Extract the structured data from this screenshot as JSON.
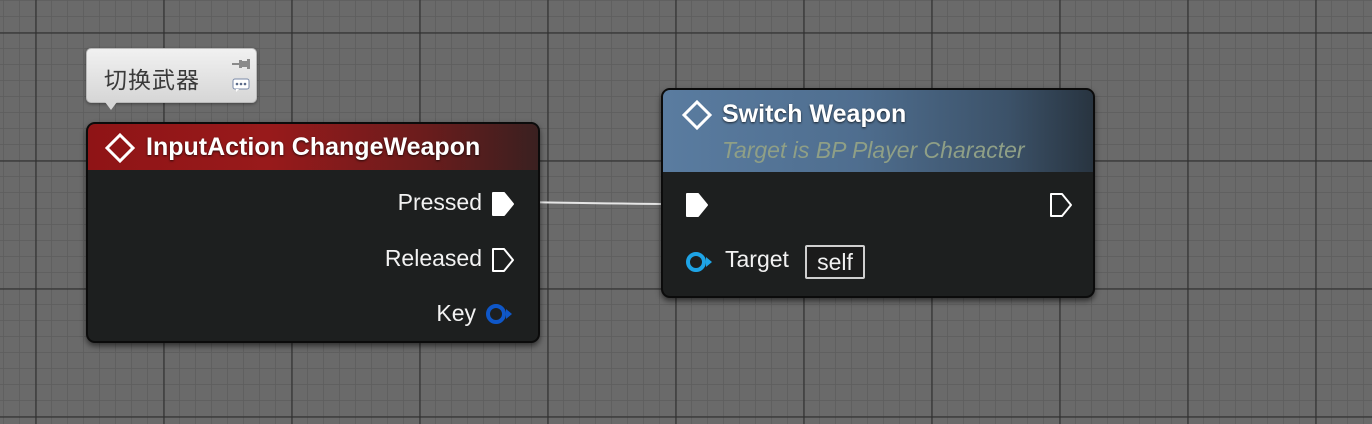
{
  "comment": {
    "text": "切换武器",
    "pin_icon": "pin-icon",
    "bubble_icon": "comment-bubble-icon"
  },
  "input_node": {
    "title": "InputAction ChangeWeapon",
    "header_color": "#8f1416",
    "pins": [
      {
        "label": "Pressed",
        "type": "exec",
        "connected": true
      },
      {
        "label": "Released",
        "type": "exec",
        "connected": false
      },
      {
        "label": "Key",
        "type": "struct",
        "color": "#0f57c8"
      }
    ]
  },
  "switch_node": {
    "title": "Switch Weapon",
    "subtitle": "Target is BP Player Character",
    "header_color": "#5a7ca0",
    "exec_in_connected": true,
    "exec_out_connected": false,
    "target": {
      "label": "Target",
      "value": "self",
      "color": "#1ea4e6"
    }
  },
  "wire": {
    "from": "Pressed",
    "to": "Switch Weapon exec in",
    "color": "#e8e8e8"
  }
}
